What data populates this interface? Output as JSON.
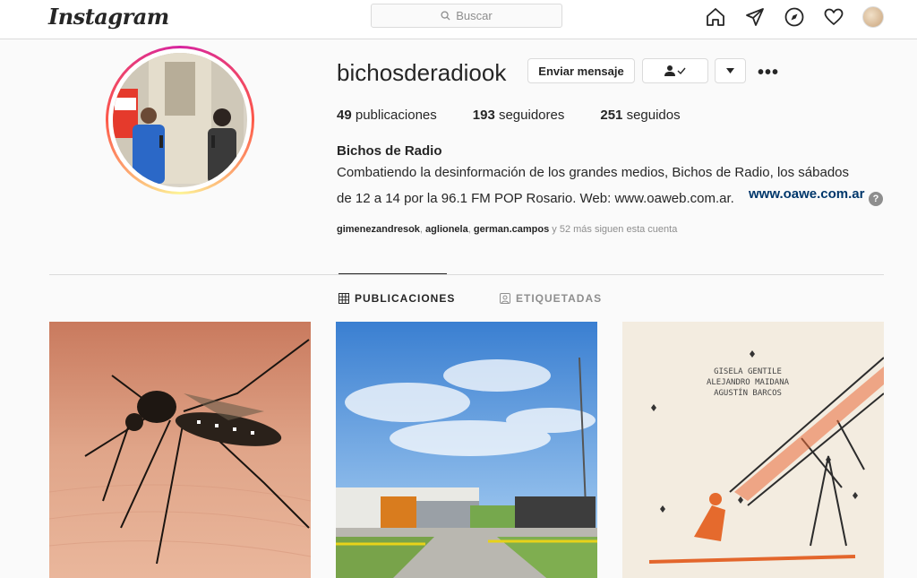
{
  "app": {
    "logo": "Instagram"
  },
  "search": {
    "placeholder": "Buscar"
  },
  "nav": {
    "icons": [
      "home-icon",
      "direct-icon",
      "explore-icon",
      "heart-icon",
      "profile-avatar"
    ]
  },
  "profile": {
    "username": "bichosderadiook",
    "buttons": {
      "message": "Enviar mensaje"
    },
    "stats": [
      {
        "count": "49",
        "label": "publicaciones"
      },
      {
        "count": "193",
        "label": "seguidores"
      },
      {
        "count": "251",
        "label": "seguidos"
      }
    ],
    "full_name": "Bichos de Radio",
    "bio_line1": "Combatiendo la desinformación de los grandes medios, Bichos de Radio, los sábados",
    "bio_line2": "de 12 a 14 por la 96.1 FM POP Rosario. Web: www.oaweb.com.ar.",
    "website": "www.oawe.com.ar",
    "help_mark": "?",
    "followed_by": [
      "gimenezandresok",
      "aglionela",
      "german.campos"
    ],
    "followed_by_more": "y 52 más siguen esta cuenta"
  },
  "tabs": {
    "posts": "PUBLICACIONES",
    "tagged": "ETIQUETADAS"
  },
  "posts": {
    "third_names": [
      "GISELA GENTILE",
      "ALEJANDRO MAIDANA",
      "AGUSTÍN BARCOS"
    ]
  },
  "colors": {
    "link": "#00376b",
    "text": "#262626",
    "muted": "#8e8e8e",
    "border": "#dbdbdb"
  }
}
